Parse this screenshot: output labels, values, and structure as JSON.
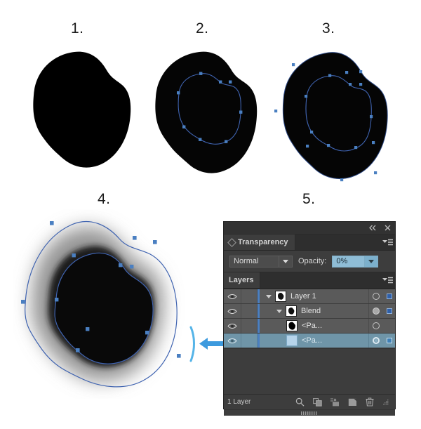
{
  "steps": [
    {
      "label": "1.",
      "caption": "solid filled shape"
    },
    {
      "label": "2.",
      "caption": "shape with inner path selected"
    },
    {
      "label": "3.",
      "caption": "two stacked paths selected"
    },
    {
      "label": "4.",
      "caption": "blend with gradient feather result"
    },
    {
      "label": "5.",
      "caption": "Transparency and Layers panels"
    }
  ],
  "panel": {
    "titlebar": {
      "collapse_icon": "double-left-chevron-icon",
      "close_icon": "close-icon"
    },
    "transparency": {
      "tab_label": "Transparency",
      "menu_icon": "panel-menu-icon",
      "blend_mode": "Normal",
      "blend_mode_options": [
        "Normal"
      ],
      "opacity_label": "Opacity:",
      "opacity_value": "0%",
      "opacity_highlighted": true,
      "highlight_color": "#8fbdd6"
    },
    "layers": {
      "tab_label": "Layers",
      "menu_icon": "panel-menu-icon",
      "rows": [
        {
          "name": "Layer 1",
          "indent": 0,
          "visible": true,
          "expanded": true,
          "has_disclosure": true,
          "thumbnail": "blob-shape-thumb",
          "color_bar": "#4a7fc1",
          "target": "ring",
          "selected_square": true,
          "selected": false
        },
        {
          "name": "Blend",
          "indent": 1,
          "visible": true,
          "expanded": true,
          "has_disclosure": true,
          "thumbnail": "blob-shape-thumb",
          "color_bar": "#4a7fc1",
          "target": "ring-filled",
          "selected_square": true,
          "selected": false
        },
        {
          "name": "<Pa...",
          "indent": 2,
          "visible": true,
          "expanded": false,
          "has_disclosure": false,
          "thumbnail": "blob-shape-thumb",
          "color_bar": "#4a7fc1",
          "target": "ring",
          "selected_square": false,
          "selected": false
        },
        {
          "name": "<Pa...",
          "indent": 2,
          "visible": true,
          "expanded": false,
          "has_disclosure": false,
          "thumbnail": "light-blue-thumb",
          "color_bar": "#4a7fc1",
          "target": "ring-double",
          "selected_square": true,
          "selected": true
        }
      ],
      "footer": {
        "count_text": "1 Layer",
        "icons": [
          "locate-object-icon",
          "make-clipping-mask-icon",
          "create-new-sublayer-icon",
          "create-new-layer-icon",
          "delete-selection-icon"
        ],
        "resize_grip": "resize-grip-icon"
      }
    }
  },
  "callout": {
    "arrow": "left-arrow-icon",
    "arrow_color": "#4aa3e0"
  },
  "colors": {
    "panel_bg": "#3d3d3d",
    "panel_header": "#2e2e2e",
    "row_bg": "#5a5a5a",
    "row_selected": "#6f95a8",
    "path_blue": "#3f63b0",
    "anchor_blue": "#4a7fc1"
  }
}
